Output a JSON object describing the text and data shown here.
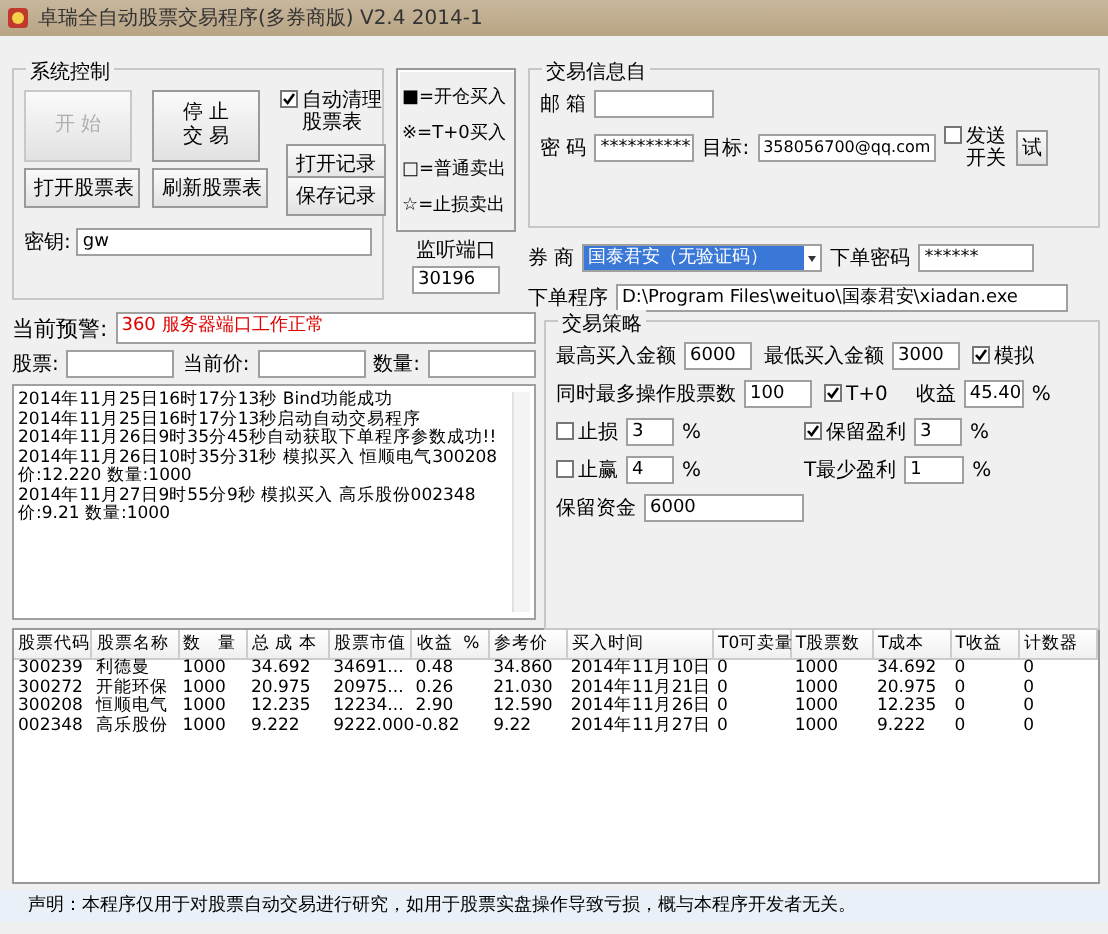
{
  "window": {
    "title": "卓瑞全自动股票交易程序(多券商版) V2.4 2014-1"
  },
  "system_control": {
    "title": "系统控制",
    "big_buttons": [
      {
        "lines": [
          "开 始"
        ],
        "disabled": true
      },
      {
        "lines": [
          "停 止",
          "交 易"
        ],
        "disabled": false
      }
    ],
    "auto_clean": {
      "label": "自动清理股票表",
      "checked": true
    },
    "buttons": [
      {
        "label": "打开股票表"
      },
      {
        "label": "刷新股票表"
      }
    ],
    "record_buttons": [
      {
        "label": "打开记录"
      },
      {
        "label": "保存记录"
      }
    ],
    "key": {
      "label": "密钥:",
      "value": "gw"
    }
  },
  "legend": [
    "■=开仓买入",
    "※=T+0买入",
    "□=普通卖出",
    "☆=止损卖出"
  ],
  "listen_port": {
    "label": "监听端口",
    "value": "30196"
  },
  "trade_info": {
    "title": "交易信息自",
    "email": {
      "label": "邮 箱"
    },
    "password": {
      "label": "密 码",
      "value": "**********"
    },
    "target": {
      "label": "目标:",
      "value": "358056700@qq.com"
    },
    "send_switch": {
      "label": "发送开关",
      "checked": false
    },
    "test_button": {
      "label": "试"
    },
    "broker": {
      "label": "券 商",
      "value": "国泰君安（无验证码）"
    },
    "order_password": {
      "label": "下单密码",
      "value": "******"
    },
    "order_program": {
      "label": "下单程序",
      "value": "D:\\Program Files\\weituo\\国泰君安\\xiadan.exe"
    }
  },
  "alert": {
    "label": "当前预警:",
    "value": "360 服务器端口工作正常"
  },
  "quote_fields": [
    {
      "label": "股票:"
    },
    {
      "label": "当前价:"
    },
    {
      "label": "数量:"
    }
  ],
  "log": [
    "2014年11月25日16时17分13秒    Bind功能成功",
    "2014年11月25日16时17分13秒启动自动交易程序",
    "2014年11月26日9时35分45秒自动获取下单程序参数成功!!",
    "2014年11月26日10时35分31秒   模拟买入 恒顺电气300208 价:12.220  数量:1000",
    "2014年11月27日9时55分9秒   模拟买入 高乐股份002348  价:9.21 数量:1000"
  ],
  "strategy": {
    "title": "交易策略",
    "fields": [
      {
        "kind": "input",
        "label": "最高买入金额",
        "value": "6000"
      },
      {
        "kind": "input",
        "label": "最低买入金额",
        "value": "3000"
      },
      {
        "kind": "check",
        "label": "模拟",
        "checked": true
      },
      {
        "kind": "input",
        "label": "同时最多操作股票数",
        "value": "100"
      },
      {
        "kind": "check",
        "label": "T+0",
        "checked": true
      },
      {
        "kind": "percent",
        "label": "收益",
        "value": "45.40",
        "unit": "%"
      },
      {
        "kind": "checkpercent",
        "label": "止损",
        "checked": false,
        "value": "3",
        "unit": "%"
      },
      {
        "kind": "checkpercent",
        "label": "保留盈利",
        "checked": true,
        "value": "3",
        "unit": "%"
      },
      {
        "kind": "checkpercent",
        "label": "止赢",
        "checked": false,
        "value": "4",
        "unit": "%"
      },
      {
        "kind": "percent",
        "label": "T最少盈利",
        "value": "1",
        "unit": "%"
      },
      {
        "kind": "input",
        "label": "保留资金",
        "value": "6000"
      }
    ]
  },
  "table": {
    "columns": [
      "股票代码",
      "股票名称",
      "数   量",
      "总 成 本",
      "股票市值",
      "收益  %",
      "参考价",
      "买入时间",
      "T0可卖量",
      "T股票数",
      "T成本",
      "T收益",
      "计数器"
    ],
    "rows": [
      [
        "300239",
        "利德曼",
        "1000",
        "34.692",
        "34691...",
        "0.48",
        "34.860",
        "2014年11月10日",
        "0",
        "1000",
        "34.692",
        "0",
        "0"
      ],
      [
        "300272",
        "开能环保",
        "1000",
        "20.975",
        "20975...",
        "0.26",
        "21.030",
        "2014年11月21日",
        "0",
        "1000",
        "20.975",
        "0",
        "0"
      ],
      [
        "300208",
        "恒顺电气",
        "1000",
        "12.235",
        "12234...",
        "2.90",
        "12.590",
        "2014年11月26日",
        "0",
        "1000",
        "12.235",
        "0",
        "0"
      ],
      [
        "002348",
        "高乐股份",
        "1000",
        "9.222",
        "9222.000",
        "-0.82",
        "9.22",
        "2014年11月27日",
        "0",
        "1000",
        "9.222",
        "0",
        "0"
      ]
    ]
  },
  "status_bar": "声明：本程序仅用于对股票自动交易进行研究，如用于股票实盘操作导致亏损，概与本程序开发者无关。"
}
